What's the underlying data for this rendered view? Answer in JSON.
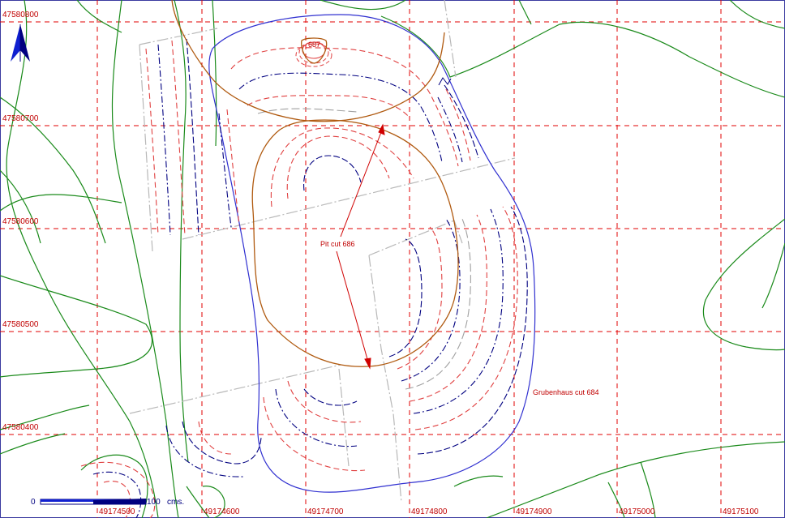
{
  "map": {
    "northing_labels": [
      "47580800",
      "47580700",
      "47580600",
      "47580500",
      "47580400"
    ],
    "easting_labels": [
      "49174500",
      "49174600",
      "49174700",
      "49174800",
      "49174900",
      "49175000",
      "49175100"
    ],
    "annotations": {
      "pit": "Pit cut 686",
      "grubenhaus": "Grubenhaus cut 684",
      "feature_687": "687"
    },
    "scale_bar": {
      "start": "0",
      "end": "100",
      "unit": "cms."
    },
    "north_arrow": "north-arrow-icon",
    "colors": {
      "grid": "#e00000",
      "contour_red": "#e04040",
      "contour_blue": "#000080",
      "contour_grey": "#a0a0a0",
      "edge_blue": "#3030d0",
      "cut_brown": "#b05a10",
      "hachure_green": "#1a8a1a",
      "trench_grey": "#b8b8b8"
    }
  }
}
